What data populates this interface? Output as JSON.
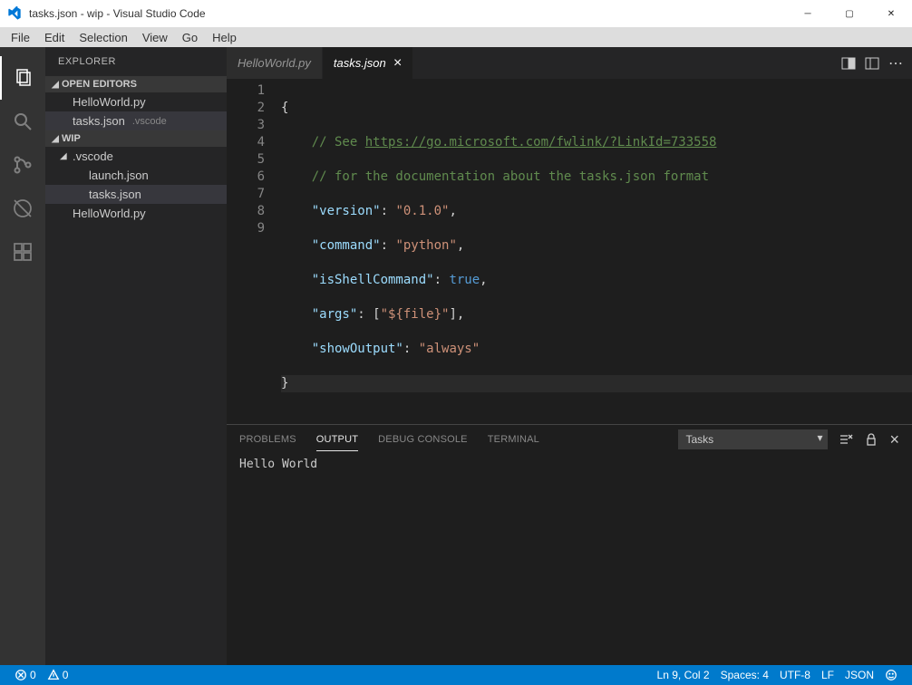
{
  "titlebar": {
    "title": "tasks.json - wip - Visual Studio Code"
  },
  "menu": {
    "items": [
      "File",
      "Edit",
      "Selection",
      "View",
      "Go",
      "Help"
    ]
  },
  "sidebar": {
    "title": "EXPLORER",
    "open_editors_label": "OPEN EDITORS",
    "open_editors": [
      {
        "name": "HelloWorld.py",
        "sub": ""
      },
      {
        "name": "tasks.json",
        "sub": ".vscode",
        "active": true
      }
    ],
    "workspace_label": "WIP",
    "tree": {
      "folder": ".vscode",
      "files": [
        "launch.json",
        "tasks.json"
      ],
      "root_files": [
        "HelloWorld.py"
      ]
    }
  },
  "editor": {
    "tabs": [
      {
        "label": "HelloWorld.py",
        "active": false
      },
      {
        "label": "tasks.json",
        "active": true
      }
    ],
    "code": {
      "comment1_prefix": "// See ",
      "comment1_url": "https://go.microsoft.com/fwlink/?LinkId=733558",
      "comment2": "// for the documentation about the tasks.json format",
      "version_key": "\"version\"",
      "version_val": "\"0.1.0\"",
      "command_key": "\"command\"",
      "command_val": "\"python\"",
      "shell_key": "\"isShellCommand\"",
      "shell_val": "true",
      "args_key": "\"args\"",
      "args_val": "\"${file}\"",
      "show_key": "\"showOutput\"",
      "show_val": "\"always\""
    },
    "line_numbers": [
      "1",
      "2",
      "3",
      "4",
      "5",
      "6",
      "7",
      "8",
      "9"
    ]
  },
  "panel": {
    "tabs": [
      "PROBLEMS",
      "OUTPUT",
      "DEBUG CONSOLE",
      "TERMINAL"
    ],
    "selected_channel": "Tasks",
    "output_text": "Hello World"
  },
  "status": {
    "errors": "0",
    "warnings": "0",
    "ln_col": "Ln 9, Col 2",
    "spaces": "Spaces: 4",
    "encoding": "UTF-8",
    "eol": "LF",
    "language": "JSON"
  }
}
